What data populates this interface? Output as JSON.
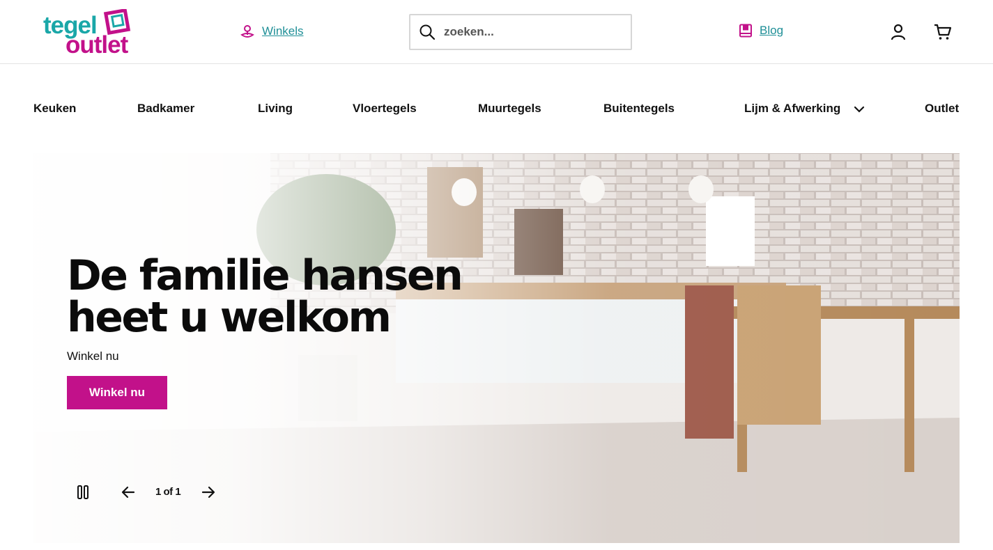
{
  "colors": {
    "brand_teal": "#1aa7a8",
    "brand_magenta": "#c2118a",
    "link_teal": "#1f8f97"
  },
  "header": {
    "logo": {
      "line1": "tegel",
      "line2": "outlet"
    },
    "stores_link": "Winkels",
    "search": {
      "placeholder": "zoeken..."
    },
    "blog_link": "Blog",
    "icons": [
      "store-pin-icon",
      "search-icon",
      "blog-book-icon",
      "user-icon",
      "cart-icon"
    ]
  },
  "nav": {
    "items": [
      "Keuken",
      "Badkamer",
      "Living",
      "Vloertegels",
      "Muurtegels",
      "Buitentegels",
      "Lijm & Afwerking",
      "Outlet"
    ]
  },
  "hero": {
    "title": "De familie hansen heet u welkom",
    "subtitle": "Winkel nu",
    "button": "Winkel nu",
    "counter": "1 of 1"
  }
}
